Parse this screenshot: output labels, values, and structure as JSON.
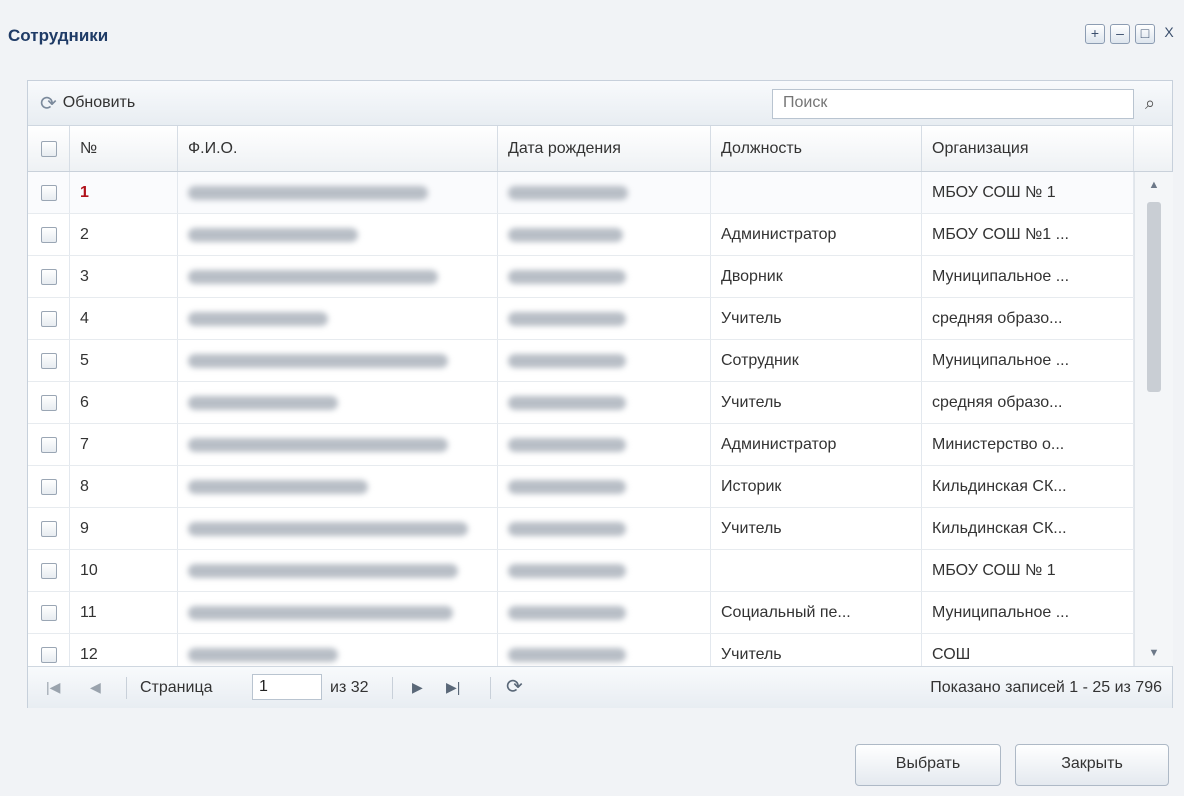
{
  "window": {
    "title": "Сотрудники",
    "buttons": [
      "+",
      "–",
      "□",
      "X"
    ]
  },
  "toolbar": {
    "refresh_label": "Обновить",
    "search_placeholder": "Поиск"
  },
  "grid": {
    "columns": [
      "№",
      "Ф.И.О.",
      "Дата рождения",
      "Должность",
      "Организация"
    ],
    "rows": [
      {
        "num": "1",
        "position": "",
        "organization": "МБОУ СОШ № 1"
      },
      {
        "num": "2",
        "position": "Администратор",
        "organization": "МБОУ СОШ №1 ..."
      },
      {
        "num": "3",
        "position": "Дворник",
        "organization": "Муниципальное ..."
      },
      {
        "num": "4",
        "position": "Учитель",
        "organization": "средняя образо..."
      },
      {
        "num": "5",
        "position": "Сотрудник",
        "organization": "Муниципальное ..."
      },
      {
        "num": "6",
        "position": "Учитель",
        "organization": "средняя образо..."
      },
      {
        "num": "7",
        "position": "Администратор",
        "organization": "Министерство о..."
      },
      {
        "num": "8",
        "position": "Историк",
        "organization": "Кильдинская СК..."
      },
      {
        "num": "9",
        "position": "Учитель",
        "organization": "Кильдинская СК..."
      },
      {
        "num": "10",
        "position": "",
        "organization": "МБОУ СОШ № 1"
      },
      {
        "num": "11",
        "position": "Социальный пе...",
        "organization": "Муниципальное ..."
      },
      {
        "num": "12",
        "position": "Учитель",
        "organization": "СОШ"
      }
    ]
  },
  "pager": {
    "page_label": "Страница",
    "page_value": "1",
    "of_label": "из 32",
    "records_text": "Показано записей 1 - 25 из 796"
  },
  "footer": {
    "select_label": "Выбрать",
    "close_label": "Закрыть"
  }
}
